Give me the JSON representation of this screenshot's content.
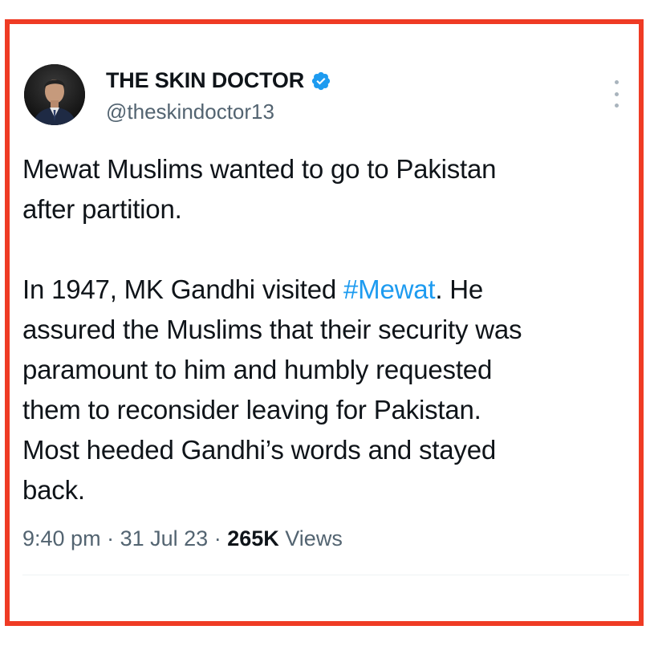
{
  "colors": {
    "frame_border": "#ef3b24",
    "text_primary": "#0f1419",
    "text_secondary": "#536471",
    "hashtag": "#1d9bf0",
    "verified_badge": "#1d9bf0"
  },
  "author": {
    "display_name": "THE SKIN DOCTOR",
    "handle": "@theskindoctor13",
    "verified_icon": "verified-badge-icon",
    "avatar_icon": "profile-photo"
  },
  "more_icon": "vertical-ellipsis-icon",
  "tweet": {
    "line1": "Mewat Muslims wanted to go to Pakistan",
    "line2": "after partition.",
    "p2_prefix": "In 1947, MK Gandhi visited ",
    "hashtag": "#Mewat",
    "p2_suffix": ". He",
    "line4": "assured the Muslims that their security was",
    "line5": "paramount to him and humbly requested",
    "line6": "them to reconsider leaving for Pakistan.",
    "line7": "Most heeded Gandhi’s words and stayed",
    "line8": "back."
  },
  "meta": {
    "time": "9:40 pm",
    "separator": "·",
    "date": "31 Jul 23",
    "views_count": "265K",
    "views_label": "Views"
  }
}
